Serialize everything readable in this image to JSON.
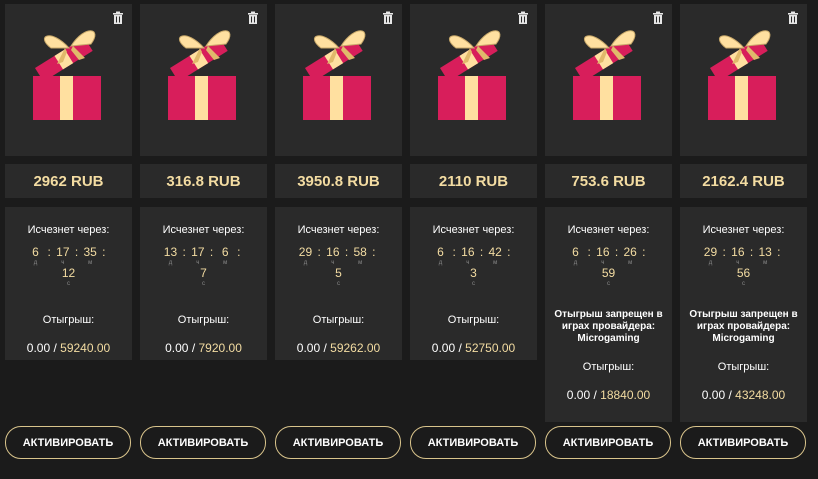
{
  "colors": {
    "accent": "#f3dca2",
    "gift_red": "#d81e5b",
    "ribbon": "#ffe0a0",
    "card_bg": "#2a2a2a",
    "page_bg": "#1b1b1b"
  },
  "icons": {
    "delete": "trash-icon",
    "gift": "gift-icon"
  },
  "labels": {
    "expires": "Исчезнет через:",
    "wager": "Отыгрыш:",
    "restriction": "Отыгрыш запрещен в играх провайдера: Microgaming",
    "activate": "АКТИВИРОВАТЬ",
    "unit_d": "д",
    "unit_h": "ч",
    "unit_m": "м",
    "unit_s": "с"
  },
  "cards": [
    {
      "price": "2962 RUB",
      "days": "6",
      "hours": "17",
      "minutes": "35",
      "seconds": "12",
      "wager_current": "0.00",
      "wager_sep": "/",
      "wager_total": "59240.00"
    },
    {
      "price": "316.8 RUB",
      "days": "13",
      "hours": "17",
      "minutes": "6",
      "seconds": "7",
      "wager_current": "0.00",
      "wager_sep": "/",
      "wager_total": "7920.00"
    },
    {
      "price": "3950.8 RUB",
      "days": "29",
      "hours": "16",
      "minutes": "58",
      "seconds": "5",
      "wager_current": "0.00",
      "wager_sep": "/",
      "wager_total": "59262.00"
    },
    {
      "price": "2110 RUB",
      "days": "6",
      "hours": "16",
      "minutes": "42",
      "seconds": "3",
      "wager_current": "0.00",
      "wager_sep": "/",
      "wager_total": "52750.00"
    },
    {
      "price": "753.6 RUB",
      "days": "6",
      "hours": "16",
      "minutes": "26",
      "seconds": "59",
      "wager_current": "0.00",
      "wager_sep": "/",
      "wager_total": "18840.00"
    },
    {
      "price": "2162.4 RUB",
      "days": "29",
      "hours": "16",
      "minutes": "13",
      "seconds": "56",
      "wager_current": "0.00",
      "wager_sep": "/",
      "wager_total": "43248.00"
    }
  ]
}
